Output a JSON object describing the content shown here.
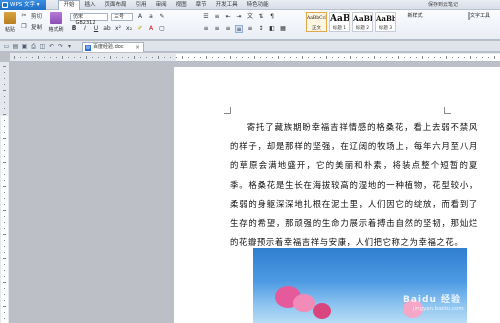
{
  "app": {
    "name": "WPS 文字",
    "sync_label": "保存到云笔记"
  },
  "menu": [
    "开始",
    "插入",
    "页面布局",
    "引用",
    "审阅",
    "视图",
    "章节",
    "开发工具",
    "特色功能"
  ],
  "ribbon": {
    "paste_label": "粘贴",
    "cut_label": "剪切",
    "copy_label": "复制",
    "format_painter_label": "格式刷",
    "font_name": "仿宋_GB2312",
    "font_size": "三号",
    "styles": [
      {
        "sample": "AaBbCcDd",
        "label": "正文"
      },
      {
        "sample": "AaBl",
        "label": "标题 1"
      },
      {
        "sample": "AaBb",
        "label": "标题 2"
      },
      {
        "sample": "AaBbC",
        "label": "标题 3"
      }
    ],
    "new_style_label": "新样式",
    "text_tools_label": "文字工具"
  },
  "doc_tab": {
    "title": "百度经验.doc"
  },
  "document": {
    "paragraph": "寄托了藏族期盼幸福吉祥情感的格桑花，看上去弱不禁风的样子，却是那样的坚强，在辽阔的牧场上，每年六月至八月的草原会满地盛开，它的美丽和朴素，将装点整个短暂的夏季。格桑花是生长在海拔较高的湿地的一种植物，花型较小，柔弱的身躯深深地扎根在泥土里，人们因它的绽放，而看到了生存的希望，那顽强的生命力展示着搏击自然的坚韧，那灿烂的花瓣预示着幸福吉祥与安康，人们把它称之为幸福之花。"
  },
  "image": {
    "watermark": "Baidu 经验",
    "watermark_sub": "jingyan.baidu.com"
  }
}
